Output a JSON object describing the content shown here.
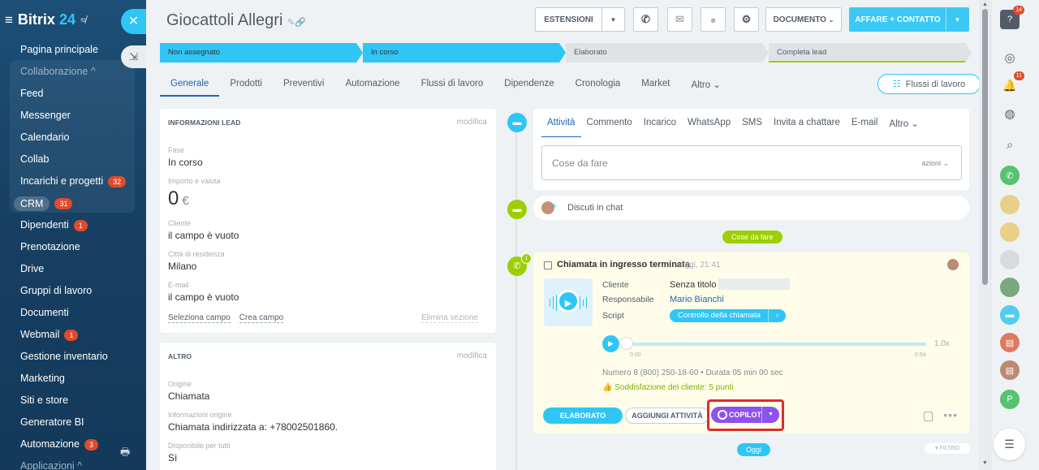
{
  "sidebar": {
    "logo": "Bitrix",
    "logo_num": "24",
    "items": [
      {
        "label": "Pagina principale",
        "sub": false
      },
      {
        "label": "Collaborazione ^",
        "sub": true
      },
      {
        "label": "Feed",
        "sub": false
      },
      {
        "label": "Messenger",
        "sub": false
      },
      {
        "label": "Calendario",
        "sub": false
      },
      {
        "label": "Collab",
        "sub": false
      },
      {
        "label": "Incarichi e progetti",
        "sub": false,
        "badge": "32"
      },
      {
        "label": "CRM",
        "sub": false,
        "badge": "31",
        "pill": true
      },
      {
        "label": "Dipendenti",
        "sub": false,
        "badge": "1"
      },
      {
        "label": "Prenotazione",
        "sub": false
      },
      {
        "label": "Drive",
        "sub": false
      },
      {
        "label": "Gruppi di lavoro",
        "sub": false
      },
      {
        "label": "Documenti",
        "sub": false
      },
      {
        "label": "Webmail",
        "sub": false,
        "badge": "1"
      },
      {
        "label": "Gestione inventario",
        "sub": false
      },
      {
        "label": "Marketing",
        "sub": false
      },
      {
        "label": "Siti e store",
        "sub": false
      },
      {
        "label": "Generatore BI",
        "sub": false
      },
      {
        "label": "Automazione",
        "sub": false,
        "badge": "3"
      },
      {
        "label": "Applicazioni ^",
        "sub": true
      }
    ]
  },
  "header": {
    "title": "Giocattoli Allegri",
    "estensioni": "ESTENSIONI",
    "documento": "DOCUMENTO",
    "affare": "AFFARE + CONTATTO"
  },
  "stages": [
    "Non assegnato",
    "In corso",
    "Elaborato",
    "Completa lead"
  ],
  "tabs": [
    "Generale",
    "Prodotti",
    "Preventivi",
    "Automazione",
    "Flussi di lavoro",
    "Dipendenze",
    "Cronologia",
    "Market",
    "Altro"
  ],
  "flow_button": "Flussi di lavoro",
  "lead_info": {
    "title": "INFORMAZIONI LEAD",
    "edit": "modifica",
    "fase_label": "Fase",
    "fase": "In corso",
    "importo_label": "Importo e valuta",
    "importo": "0",
    "currency": "€",
    "cliente_label": "Cliente",
    "cliente": "il campo è vuoto",
    "citta_label": "Città di residenza",
    "citta": "Milano",
    "email_label": "E-mail",
    "email": "il campo è vuoto",
    "select_field": "Seleziona campo",
    "create_field": "Crea campo",
    "delete_section": "Elimina sezione"
  },
  "altro": {
    "title": "ALTRO",
    "edit": "modifica",
    "origine_label": "Origine",
    "origine": "Chiamata",
    "info_label": "Informazioni origine",
    "info": "Chiamata indirizzata a: +78002501860.",
    "disp_label": "Disponibile per tutti",
    "disp": "Sì"
  },
  "activity": {
    "tabs": [
      "Attività",
      "Commento",
      "Incarico",
      "WhatsApp",
      "SMS",
      "Invita a chattare",
      "E-mail",
      "Altro"
    ],
    "placeholder": "Cose da fare",
    "azioni": "azioni"
  },
  "chat": {
    "text": "Discuti in chat"
  },
  "pill_todo": "Cose da fare",
  "pill_today": "Oggi",
  "call": {
    "title": "Chiamata in ingresso terminata",
    "time": "oggi, 21:41",
    "client_label": "Cliente",
    "client": "Senza titolo",
    "resp_label": "Responsabile",
    "resp": "Mario Bianchi",
    "script_label": "Script",
    "script_btn": "Controllo della chiamata",
    "speed": "1.0x",
    "t_start": "0:00",
    "t_end": "0:54",
    "number": "Numero 8 (800) 250-18-60 • Durata 05 min 00 sec",
    "satisfaction": "Soddisfazione del cliente: 5 punti",
    "btn_done": "ELABORATO",
    "btn_assign": "AGGIUNGI ATTIVITÀ",
    "btn_copilot": "COPILOT",
    "badge": "1"
  },
  "filter": "FILTRO",
  "right": {
    "help_badge": "14",
    "bell_badge": "11",
    "p_letter": "P"
  },
  "colors": {
    "accent": "#2fc6f6",
    "brand_dark": "#1c4f77",
    "copilot": "#8e52ec",
    "success": "#9dcf00",
    "highlight": "#e02b2b"
  }
}
